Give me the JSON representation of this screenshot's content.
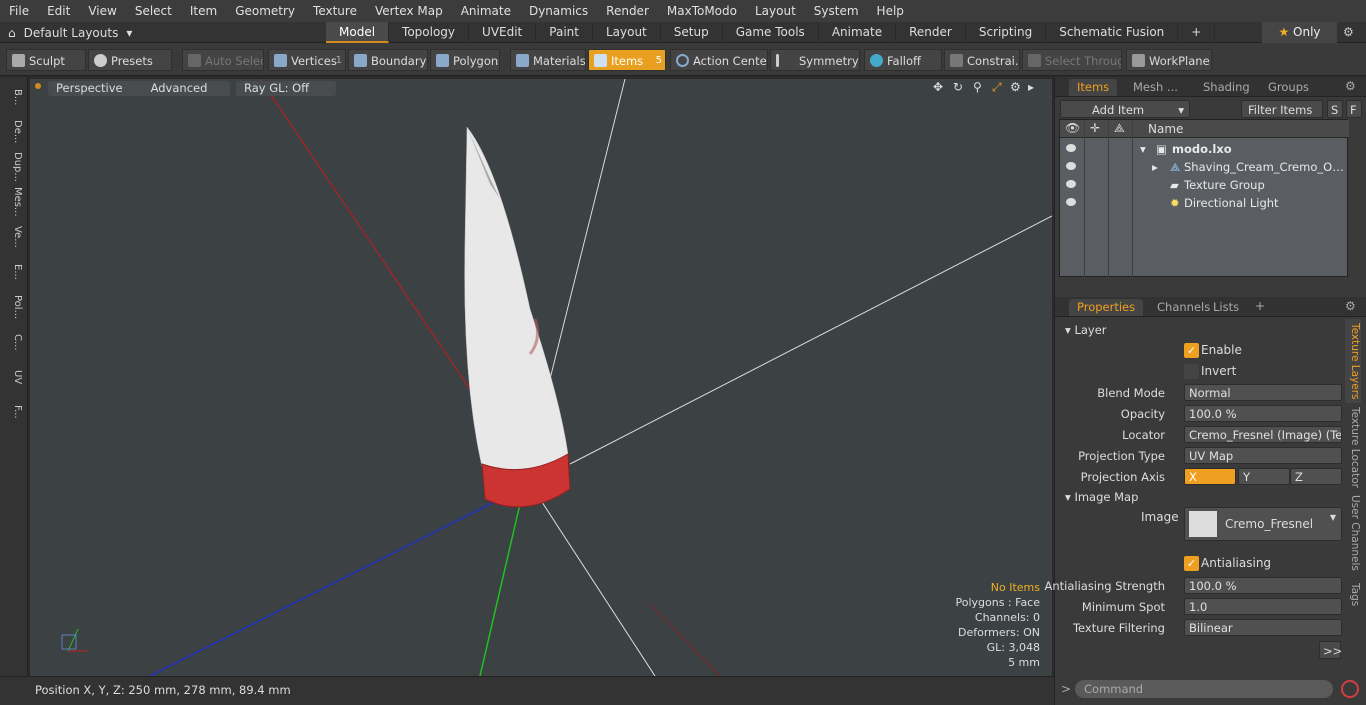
{
  "menu": [
    "File",
    "Edit",
    "View",
    "Select",
    "Item",
    "Geometry",
    "Texture",
    "Vertex Map",
    "Animate",
    "Dynamics",
    "Render",
    "MaxToModo",
    "Layout",
    "System",
    "Help"
  ],
  "layouts": {
    "label": "Default Layouts"
  },
  "tabs": [
    "Model",
    "Topology",
    "UVEdit",
    "Paint",
    "Layout",
    "Setup",
    "Game Tools",
    "Animate",
    "Render",
    "Scripting",
    "Schematic Fusion"
  ],
  "only": "Only",
  "toolbar": {
    "sculpt": "Sculpt",
    "presets": "Presets",
    "auto_select": "Auto Select",
    "vertices": "Vertices",
    "vertices_count": "1",
    "boundary": "Boundary",
    "polygons": "Polygons",
    "materials": "Materials",
    "items": "Items",
    "items_count": "5",
    "action_center": "Action Center",
    "symmetry": "Symmetry",
    "falloff": "Falloff",
    "constraints": "Constrai...",
    "select_through": "Select Through",
    "workplane": "WorkPlane"
  },
  "leftstrip": [
    "B...",
    "De...",
    "Dup...",
    "Mes...",
    "Ve...",
    "E...",
    "Pol...",
    "C...",
    "UV",
    "F..."
  ],
  "viewport": {
    "perspective": "Perspective",
    "advanced": "Advanced",
    "raygl": "Ray GL: Off",
    "info": {
      "no_items": "No Items",
      "polygons": "Polygons : Face",
      "channels": "Channels: 0",
      "deformers": "Deformers: ON",
      "gl": "GL: 3,048",
      "unit": "5 mm"
    }
  },
  "status": "Position X, Y, Z:  250 mm, 278 mm, 89.4 mm",
  "items_panel": {
    "tabs": [
      "Items",
      "Mesh ...",
      "Shading",
      "Groups"
    ],
    "add_item": "Add Item",
    "filter": "Filter Items",
    "s": "S",
    "f": "F",
    "name_col": "Name",
    "rows": [
      "modo.lxo",
      "Shaving_Cream_Cremo_Origin ...",
      "Texture Group",
      "Directional Light"
    ]
  },
  "props": {
    "tabs": [
      "Properties",
      "Channels",
      "Lists"
    ],
    "layer": "Layer",
    "enable": "Enable",
    "invert": "Invert",
    "blend_mode_label": "Blend Mode",
    "blend_mode": "Normal",
    "opacity_label": "Opacity",
    "opacity": "100.0 %",
    "locator_label": "Locator",
    "locator": "Cremo_Fresnel (Image) (Text...",
    "proj_type_label": "Projection Type",
    "proj_type": "UV Map",
    "proj_axis_label": "Projection Axis",
    "axis": [
      "X",
      "Y",
      "Z"
    ],
    "image_map": "Image Map",
    "image_label": "Image",
    "image": "Cremo_Fresnel",
    "antialiasing": "Antialiasing",
    "aa_strength_label": "Antialiasing Strength",
    "aa_strength": "100.0 %",
    "min_spot_label": "Minimum Spot",
    "min_spot": "1.0",
    "tex_filter_label": "Texture Filtering",
    "tex_filter": "Bilinear",
    "more": ">>",
    "vtabs": [
      "Texture Layers",
      "Texture Locator",
      "User Channels",
      "Tags"
    ]
  },
  "command": "Command"
}
